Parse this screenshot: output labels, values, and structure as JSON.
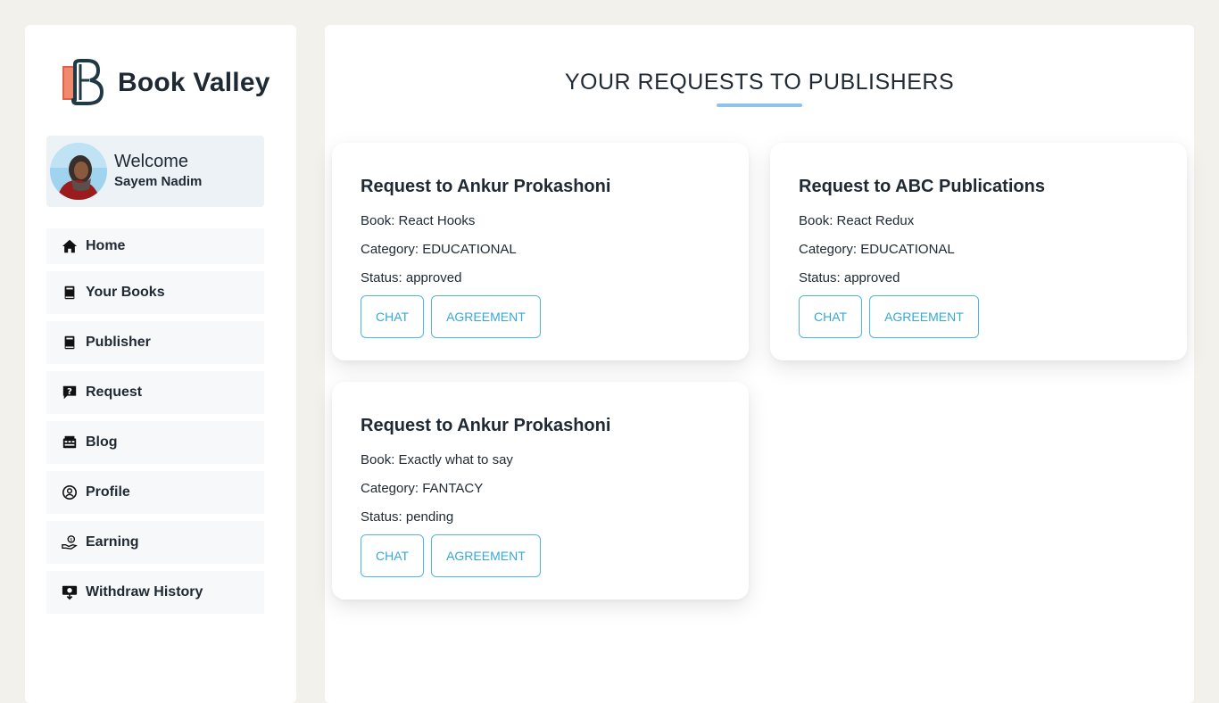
{
  "brand": {
    "name": "Book Valley",
    "logo_icon": "book-valley-logo"
  },
  "welcome": {
    "title": "Welcome",
    "user": "Sayem Nadim"
  },
  "nav": {
    "items": [
      {
        "label": "Home",
        "icon": "home-icon"
      },
      {
        "label": "Your Books",
        "icon": "book-icon"
      },
      {
        "label": "Publisher",
        "icon": "book-icon"
      },
      {
        "label": "Request",
        "icon": "question-message-icon"
      },
      {
        "label": "Blog",
        "icon": "blog-icon"
      },
      {
        "label": "Profile",
        "icon": "user-circle-icon"
      },
      {
        "label": "Earning",
        "icon": "earning-hand-icon"
      },
      {
        "label": "Withdraw History",
        "icon": "withdraw-icon"
      }
    ]
  },
  "page": {
    "title": "YOUR REQUESTS TO PUBLISHERS"
  },
  "requests": [
    {
      "title": "Request to Ankur Prokashoni",
      "book": "Book: React Hooks",
      "category": "Category: EDUCATIONAL",
      "status": "Status: approved",
      "chat_label": "CHAT",
      "agreement_label": "AGREEMENT"
    },
    {
      "title": "Request to ABC Publications",
      "book": "Book: React Redux",
      "category": "Category: EDUCATIONAL",
      "status": "Status: approved",
      "chat_label": "CHAT",
      "agreement_label": "AGREEMENT"
    },
    {
      "title": "Request to Ankur Prokashoni",
      "book": "Book: Exactly what to say",
      "category": "Category: FANTACY",
      "status": "Status: pending",
      "chat_label": "CHAT",
      "agreement_label": "AGREEMENT"
    }
  ],
  "colors": {
    "background": "#f2f1ec",
    "accent": "#35a8d8",
    "underline": "#90c2f0"
  }
}
